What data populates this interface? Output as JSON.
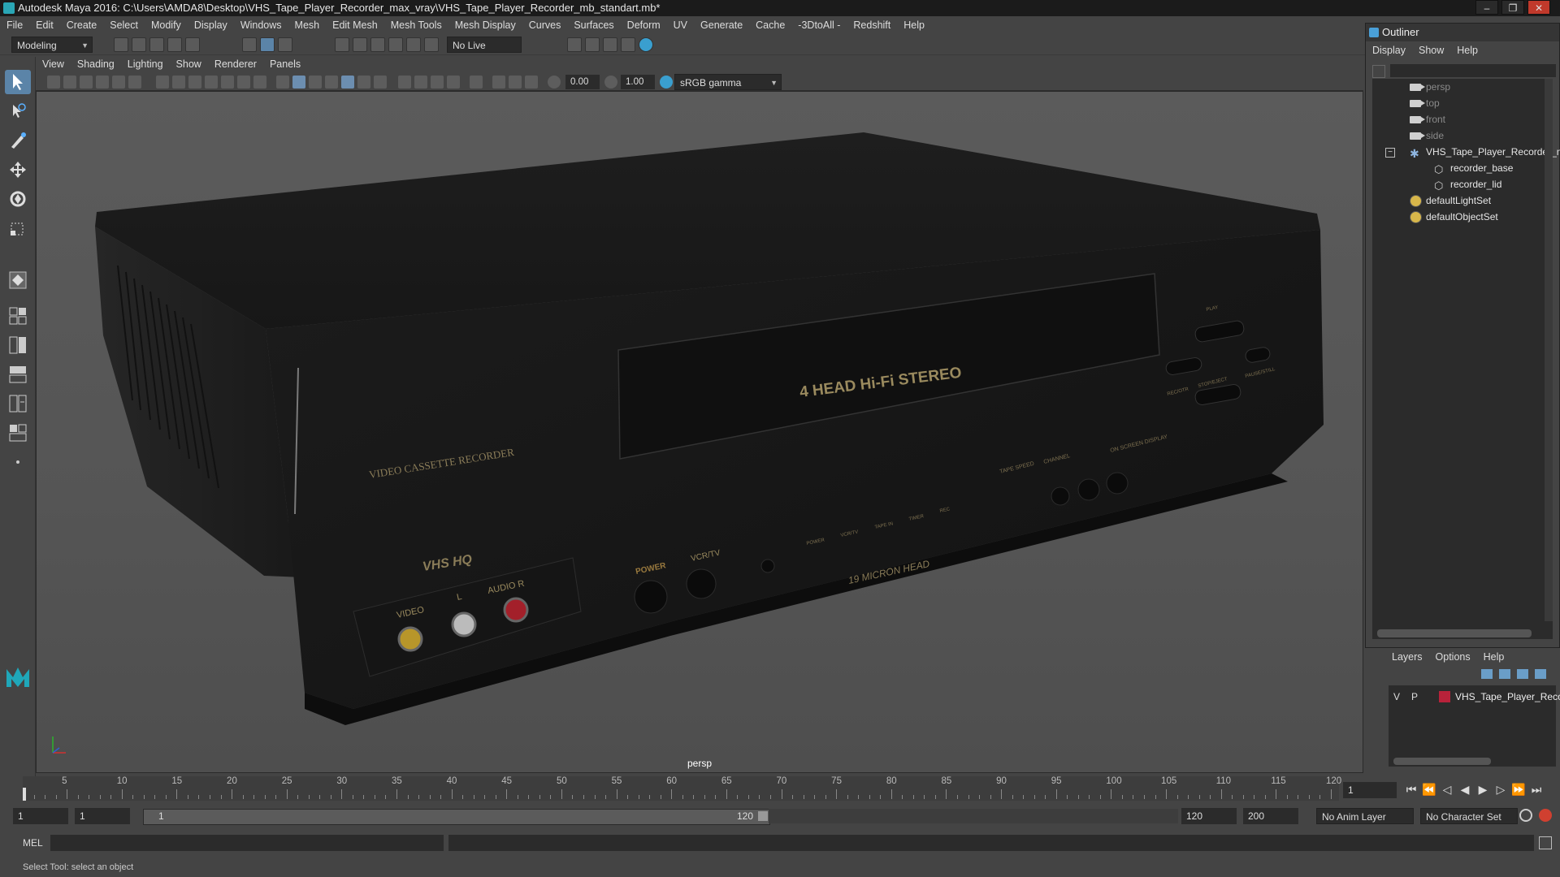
{
  "window": {
    "title": "Autodesk Maya 2016: C:\\Users\\AMDA8\\Desktop\\VHS_Tape_Player_Recorder_max_vray\\VHS_Tape_Player_Recorder_mb_standart.mb*",
    "minimize": "‒",
    "maximize": "❐",
    "close": "✕"
  },
  "menubar": [
    "File",
    "Edit",
    "Create",
    "Select",
    "Modify",
    "Display",
    "Windows",
    "Mesh",
    "Edit Mesh",
    "Mesh Tools",
    "Mesh Display",
    "Curves",
    "Surfaces",
    "Deform",
    "UV",
    "Generate",
    "Cache",
    "-3DtoAll -",
    "Redshift",
    "Help"
  ],
  "statusline": {
    "mode": "Modeling",
    "live_surface": "No Live Surface"
  },
  "viewport": {
    "menus": [
      "View",
      "Shading",
      "Lighting",
      "Show",
      "Renderer",
      "Panels"
    ],
    "exposure": "0.00",
    "gamma": "1.00",
    "color_space": "sRGB gamma",
    "camera_label": "persp"
  },
  "model": {
    "front_label": "4 HEAD Hi-Fi STEREO",
    "side_label": "VIDEO CASSETTE RECORDER",
    "logo": "VHS HQ",
    "jack_video": "VIDEO",
    "jack_l": "L",
    "jack_audio_r": "AUDIO  R",
    "power": "POWER",
    "vcr_tv": "VCR/TV",
    "micron": "19 MICRON HEAD",
    "indicators": [
      "POWER",
      "VCR/TV",
      "TAPE IN",
      "TIMER",
      "REC"
    ],
    "tape_speed": "TAPE SPEED",
    "channel": "CHANNEL",
    "on_screen": "ON SCREEN DISPLAY",
    "play": "PLAY",
    "rec_otr": "REC/OTR",
    "stop_eject": "STOP/EJECT",
    "pause_still": "PAUSE/STILL"
  },
  "outliner": {
    "title": "Outliner",
    "menus": [
      "Display",
      "Show",
      "Help"
    ],
    "items": [
      {
        "label": "persp",
        "type": "camera",
        "indent": 0,
        "dim": true
      },
      {
        "label": "top",
        "type": "camera",
        "indent": 0,
        "dim": true
      },
      {
        "label": "front",
        "type": "camera",
        "indent": 0,
        "dim": true
      },
      {
        "label": "side",
        "type": "camera",
        "indent": 0,
        "dim": true
      },
      {
        "label": "VHS_Tape_Player_Recorder_ncl",
        "type": "group",
        "indent": 0,
        "dim": false
      },
      {
        "label": "recorder_base",
        "type": "mesh",
        "indent": 1,
        "dim": false
      },
      {
        "label": "recorder_lid",
        "type": "mesh",
        "indent": 1,
        "dim": false
      },
      {
        "label": "defaultLightSet",
        "type": "set",
        "indent": 0,
        "dim": false
      },
      {
        "label": "defaultObjectSet",
        "type": "set",
        "indent": 0,
        "dim": false
      }
    ]
  },
  "layers": {
    "menus": [
      "Layers",
      "Options",
      "Help"
    ],
    "row": {
      "v": "V",
      "p": "P",
      "name": "VHS_Tape_Player_Reco",
      "color": "#b8223a"
    }
  },
  "timeline": {
    "ticks": [
      5,
      10,
      15,
      20,
      25,
      30,
      35,
      40,
      45,
      50,
      55,
      60,
      65,
      70,
      75,
      80,
      85,
      90,
      95,
      100,
      105,
      110,
      115,
      120
    ],
    "min": 1,
    "max": 120,
    "current_frame": "1"
  },
  "range": {
    "start": "1",
    "anim_start": "1",
    "slider_start": "1",
    "slider_end": "120",
    "anim_end": "120",
    "end": "200",
    "anim_layer": "No Anim Layer",
    "char_set": "No Character Set"
  },
  "cmd": {
    "label": "MEL"
  },
  "help": {
    "text": "Select Tool: select an object"
  }
}
